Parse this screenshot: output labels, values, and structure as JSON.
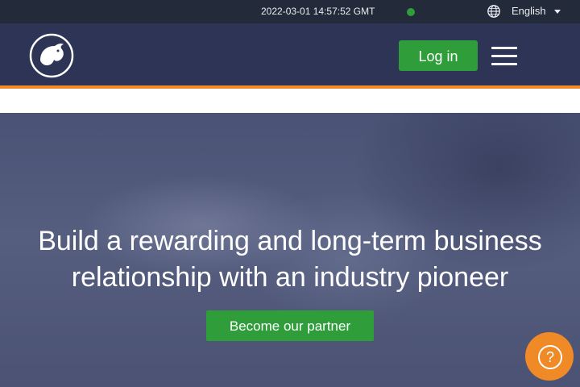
{
  "topbar": {
    "time": "2022-03-01 14:57:52 GMT",
    "status_color": "#2f9e3a",
    "language": "English",
    "globe_icon": "globe-icon",
    "caret_icon": "caret-down-icon"
  },
  "header": {
    "logo_icon": "brand-logo",
    "login_label": "Log in",
    "menu_icon": "hamburger-menu-icon"
  },
  "hero": {
    "title": "Build a rewarding and long-term business relationship with an industry pioneer",
    "cta_label": "Become our partner"
  },
  "help": {
    "icon": "question-mark-icon",
    "symbol": "?"
  },
  "colors": {
    "header_bg": "#2d3455",
    "topbar_bg": "#232a3a",
    "accent_orange": "#ef8a27",
    "button_green": "#2f9e3a"
  }
}
